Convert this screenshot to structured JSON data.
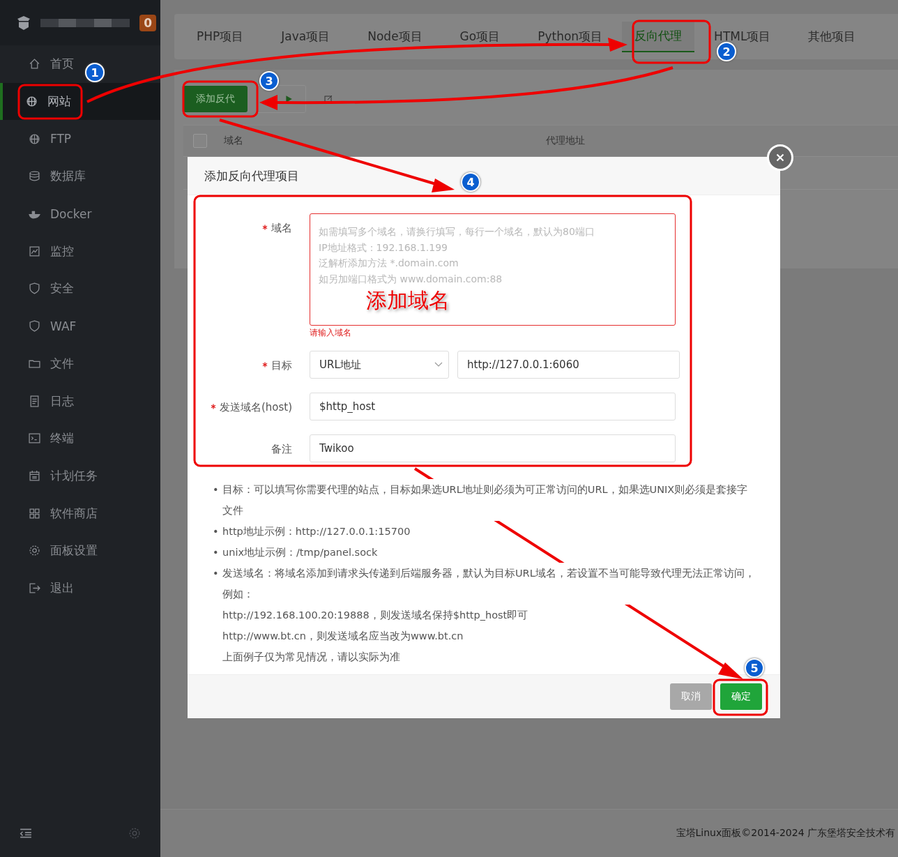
{
  "sidebar": {
    "badge": "0",
    "items": [
      {
        "label": "首页",
        "selected": false
      },
      {
        "label": "网站",
        "selected": true
      },
      {
        "label": "FTP",
        "selected": false
      },
      {
        "label": "数据库",
        "selected": false
      },
      {
        "label": "Docker",
        "selected": false
      },
      {
        "label": "监控",
        "selected": false
      },
      {
        "label": "安全",
        "selected": false
      },
      {
        "label": "WAF",
        "selected": false
      },
      {
        "label": "文件",
        "selected": false
      },
      {
        "label": "日志",
        "selected": false
      },
      {
        "label": "终端",
        "selected": false
      },
      {
        "label": "计划任务",
        "selected": false
      },
      {
        "label": "软件商店",
        "selected": false
      },
      {
        "label": "面板设置",
        "selected": false
      },
      {
        "label": "退出",
        "selected": false
      }
    ]
  },
  "tabs": [
    {
      "label": "PHP项目",
      "selected": false
    },
    {
      "label": "Java项目",
      "selected": false
    },
    {
      "label": "Node项目",
      "selected": false
    },
    {
      "label": "Go项目",
      "selected": false
    },
    {
      "label": "Python项目",
      "selected": false
    },
    {
      "label": "反向代理",
      "selected": true
    },
    {
      "label": "HTML项目",
      "selected": false
    },
    {
      "label": "其他项目",
      "selected": false
    }
  ],
  "toolbar": {
    "add_button": "添加反代"
  },
  "table": {
    "select_all_checked": false,
    "columns": [
      "域名",
      "代理地址"
    ]
  },
  "dialog": {
    "title": "添加反向代理项目",
    "fields": [
      {
        "kind": "textarea",
        "label": "域名",
        "required": true,
        "placeholder": "如需填写多个域名，请换行填写，每行一个域名，默认为80端口\nIP地址格式：192.168.1.199\n泛解析添加方法 *.domain.com\n如另加端口格式为 www.domain.com:88",
        "error": "请输入域名"
      },
      {
        "kind": "select-input",
        "label": "目标",
        "required": true,
        "select": "URL地址",
        "value": "http://127.0.0.1:6060"
      },
      {
        "kind": "input",
        "label": "发送域名(host)",
        "required": true,
        "value": "$http_host"
      },
      {
        "kind": "input",
        "label": "备注",
        "required": false,
        "value": "Twikoo"
      }
    ],
    "notes": [
      {
        "marker": "•",
        "text": "目标：可以填写你需要代理的站点，目标如果选URL地址则必须为可正常访问的URL，如果选UNIX则必须是套接字文件"
      },
      {
        "marker": "•",
        "text": "http地址示例：http://127.0.0.1:15700"
      },
      {
        "marker": "•",
        "text": "unix地址示例：/tmp/panel.sock"
      },
      {
        "marker": "•",
        "text": "发送域名：将域名添加到请求头传递到后端服务器，默认为目标URL域名，若设置不当可能导致代理无法正常访问，例如：",
        "lines": [
          "http://192.168.100.20:19888，则发送域名保持$http_host即可",
          "http://www.bt.cn，则发送域名应当改为www.bt.cn",
          "上面例子仅为常见情况，请以实际为准"
        ]
      }
    ],
    "buttons": [
      {
        "label": "取消",
        "kind": "cancel"
      },
      {
        "label": "确定",
        "kind": "confirm"
      }
    ]
  },
  "annotations": {
    "markers": [
      "1",
      "2",
      "3",
      "4",
      "5"
    ],
    "callout": "添加域名"
  },
  "footer": {
    "copyright": "宝塔Linux面板©2014-2024 广东堡塔安全技术有"
  }
}
